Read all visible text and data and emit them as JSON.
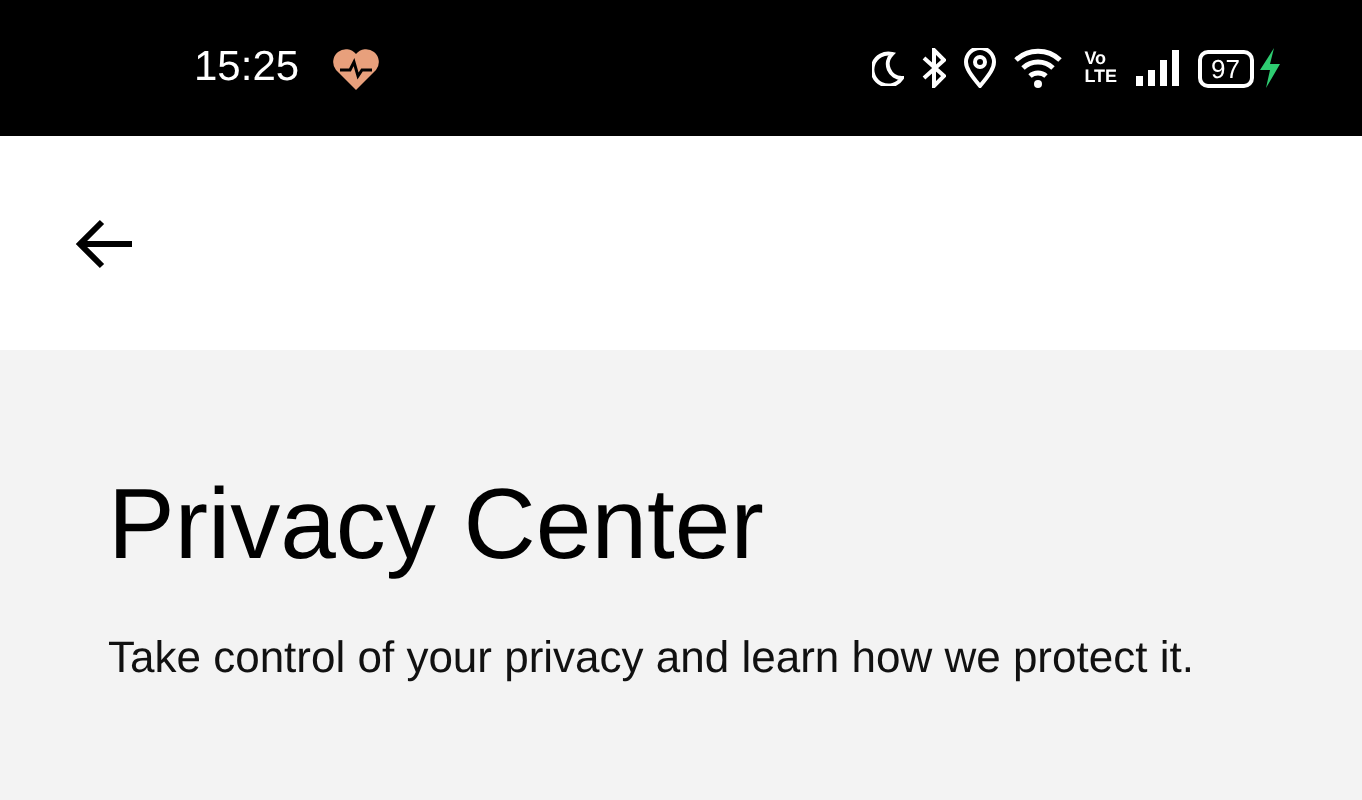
{
  "status_bar": {
    "time": "15:25",
    "volte": [
      "Vo",
      "LTE"
    ],
    "battery": "97"
  },
  "page": {
    "title": "Privacy Center",
    "subtitle": "Take control of your privacy and learn how we protect it."
  }
}
